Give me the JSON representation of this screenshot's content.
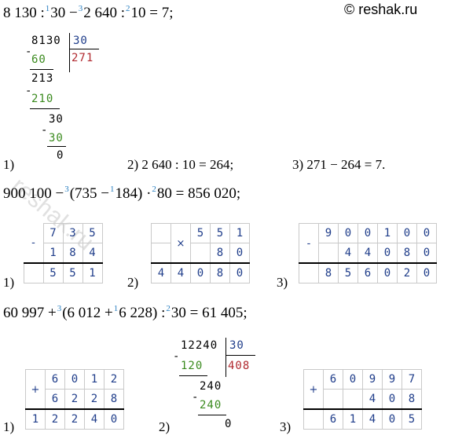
{
  "brand": "© reshak.ru",
  "watermark_text": "reshak.ru",
  "problem1": {
    "eq_a": "8 130 :",
    "order1": "1",
    "eq_b": "30 −",
    "order3": "3",
    "eq_c": "2 640 :",
    "order2": "2",
    "eq_d": "10 = 7;",
    "division": {
      "dividend": "8130",
      "divisor": "30",
      "quotient": "271",
      "sub1": "60",
      "rem1": "213",
      "sub2": "210",
      "rem2": "30",
      "sub3": "30",
      "rem3": "0",
      "minus": "-"
    },
    "step1_label": "1)",
    "step2": "2) 2 640 : 10 = 264;",
    "step3": "3) 271 − 264 = 7."
  },
  "problem2": {
    "eq_a": "900 100 −",
    "order3": "3",
    "eq_b": "(735 −",
    "order1": "1",
    "eq_c": "184) ·",
    "order2": "2",
    "eq_d": "80 = 856 020;",
    "step1_label": "1)",
    "step2_label": "2)",
    "step3_label": "3)",
    "sub1": {
      "op": "-",
      "row1": [
        "7",
        "3",
        "5"
      ],
      "row2": [
        "1",
        "8",
        "4"
      ],
      "result": [
        "5",
        "5",
        "1"
      ]
    },
    "mul": {
      "op": "×",
      "row1": [
        "5",
        "5",
        "1"
      ],
      "row2": [
        "",
        "8",
        "0"
      ],
      "result": [
        "4",
        "4",
        "0",
        "8",
        "0"
      ]
    },
    "sub2": {
      "op": "-",
      "row1": [
        "9",
        "0",
        "0",
        "1",
        "0",
        "0"
      ],
      "row2": [
        "",
        "4",
        "4",
        "0",
        "8",
        "0"
      ],
      "result": [
        "8",
        "5",
        "6",
        "0",
        "2",
        "0"
      ]
    }
  },
  "problem3": {
    "eq_a": "60 997 +",
    "order3": "3",
    "eq_b": "(6 012 +",
    "order1": "1",
    "eq_c": "6 228) :",
    "order2": "2",
    "eq_d": "30 = 61 405;",
    "step1_label": "1)",
    "step2_label": "2)",
    "step3_label": "3)",
    "add1": {
      "op": "+",
      "row1": [
        "6",
        "0",
        "1",
        "2"
      ],
      "row2": [
        "6",
        "2",
        "2",
        "8"
      ],
      "result": [
        "1",
        "2",
        "2",
        "4",
        "0"
      ]
    },
    "division": {
      "dividend": "12240",
      "divisor": "30",
      "quotient": "408",
      "sub1": "120",
      "rem1": "240",
      "sub2": "240",
      "rem2": "0",
      "minus": "-"
    },
    "add2": {
      "op": "+",
      "row1": [
        "6",
        "0",
        "9",
        "9",
        "7"
      ],
      "row2": [
        "",
        "",
        "4",
        "0",
        "8"
      ],
      "result": [
        "6",
        "1",
        "4",
        "0",
        "5"
      ]
    }
  }
}
